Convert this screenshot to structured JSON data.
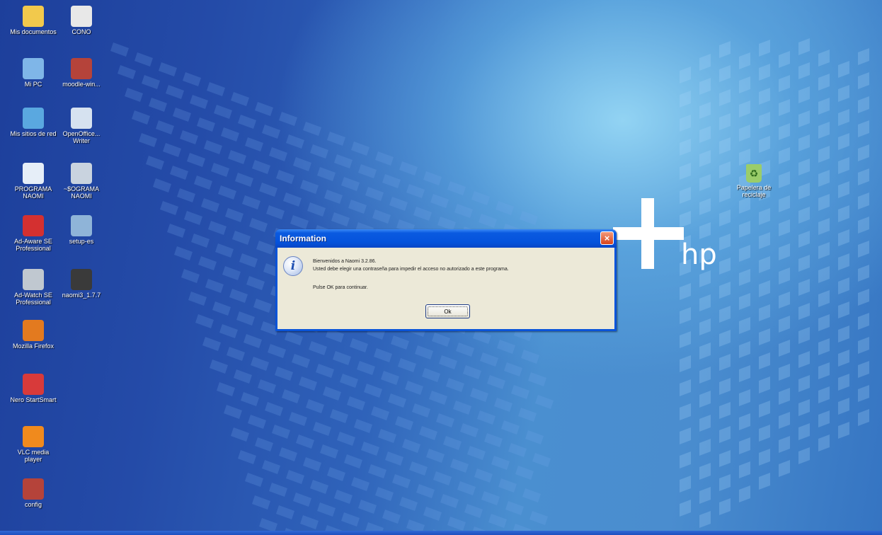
{
  "desktop": {
    "background_brand": "hp",
    "icons_left": [
      {
        "label": "Mis documentos",
        "icon": "folder-icon",
        "color": "#f2c94c"
      },
      {
        "label": "CONO",
        "icon": "text-file-icon",
        "color": "#e8e8e8"
      },
      {
        "label": "Mi PC",
        "icon": "computer-icon",
        "color": "#7fb6e8"
      },
      {
        "label": "moodle-win...",
        "icon": "archive-icon",
        "color": "#b5433a"
      },
      {
        "label": "Mis sitios de red",
        "icon": "network-icon",
        "color": "#5aa8e0"
      },
      {
        "label": "OpenOffice... Writer",
        "icon": "writer-doc-icon",
        "color": "#d6e2f0"
      },
      {
        "label": "PROGRAMA NAOMI",
        "icon": "program-icon",
        "color": "#e6eef8"
      },
      {
        "label": "~$OGRAMA NAOMI",
        "icon": "program-icon",
        "color": "#c9d3df"
      },
      {
        "label": "Ad-Aware SE Professional",
        "icon": "ad-aware-icon",
        "color": "#d43030"
      },
      {
        "label": "setup-es",
        "icon": "setup-icon",
        "color": "#8fb4d8"
      },
      {
        "label": "Ad-Watch SE Professional",
        "icon": "ad-watch-icon",
        "color": "#c0c8d0"
      },
      {
        "label": "naomi3_1.7.7",
        "icon": "app-icon",
        "color": "#3a3a3a"
      },
      {
        "label": "Mozilla Firefox",
        "icon": "firefox-icon",
        "color": "#e37a1f"
      },
      {
        "label": "Nero StartSmart",
        "icon": "nero-icon",
        "color": "#d83a3a"
      },
      {
        "label": "VLC media player",
        "icon": "vlc-icon",
        "color": "#f08a1d"
      },
      {
        "label": "config",
        "icon": "archive-icon",
        "color": "#b5433a"
      }
    ],
    "recycle_bin": {
      "label": "Papelera de reciclaje",
      "icon": "recycle-bin-icon",
      "color": "#9acd6a"
    }
  },
  "dialog": {
    "title": "Information",
    "close_label": "×",
    "line1": "Bienvenidos a Naomi 3.2.86.",
    "line2": "Usted debe elegir una contraseña para impedir el acceso no autorizado a este programa.",
    "line3": "Pulse OK para continuar.",
    "ok_label": "Ok",
    "info_symbol": "i"
  }
}
